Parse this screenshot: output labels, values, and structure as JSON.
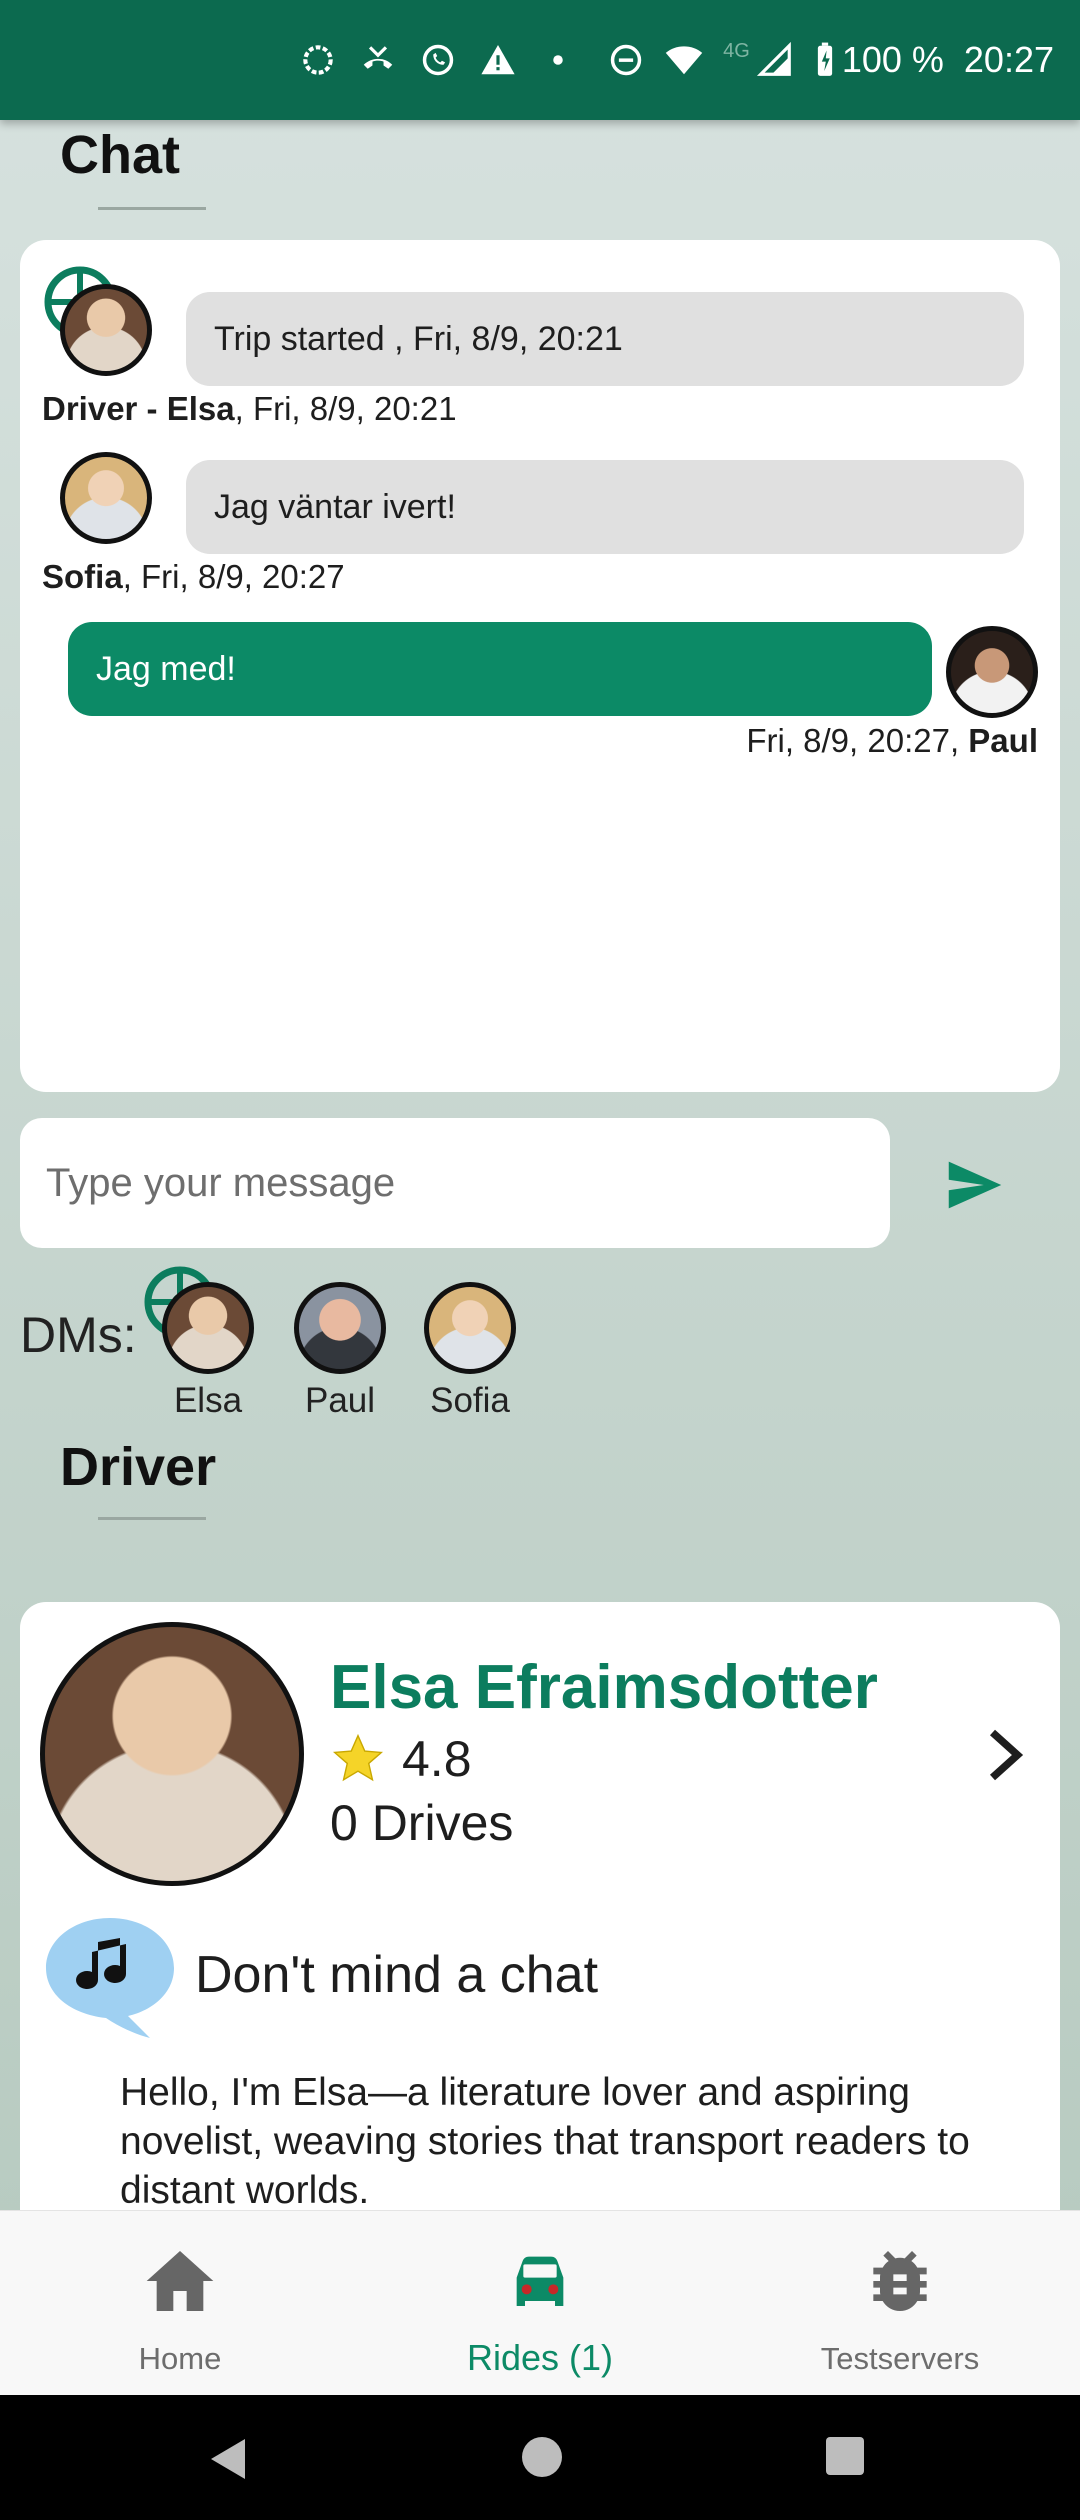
{
  "status_bar": {
    "battery": "100 %",
    "time": "20:27",
    "network": "4G"
  },
  "chat": {
    "title": "Chat",
    "messages": [
      {
        "text": "Trip started ,  Fri, 8/9, 20:21",
        "sender": "Driver - Elsa",
        "time": ",  Fri, 8/9, 20:21"
      },
      {
        "text": "Jag väntar ivert!",
        "sender": "Sofia",
        "time": ",  Fri, 8/9, 20:27"
      },
      {
        "text": "Jag med!",
        "sender": "Paul",
        "time": "Fri, 8/9, 20:27,  "
      }
    ],
    "input_placeholder": "Type your message"
  },
  "dms": {
    "label": "DMs:",
    "contacts": [
      "Elsa",
      "Paul",
      "Sofia"
    ]
  },
  "driver": {
    "title": "Driver",
    "name": "Elsa Efraimsdotter",
    "rating": "4.8",
    "drives": "0 Drives",
    "preference": "Don't mind a chat",
    "bio": "Hello, I'm Elsa—a literature lover and aspiring novelist, weaving stories that transport readers to distant worlds."
  },
  "bottom_nav": {
    "items": [
      "Home",
      "Rides (1)",
      "Testservers"
    ],
    "active": "Rides (1)"
  },
  "colors": {
    "brand": "#0c6a4f",
    "accent": "#0c8a66",
    "driver_name": "#0c7d5e"
  }
}
